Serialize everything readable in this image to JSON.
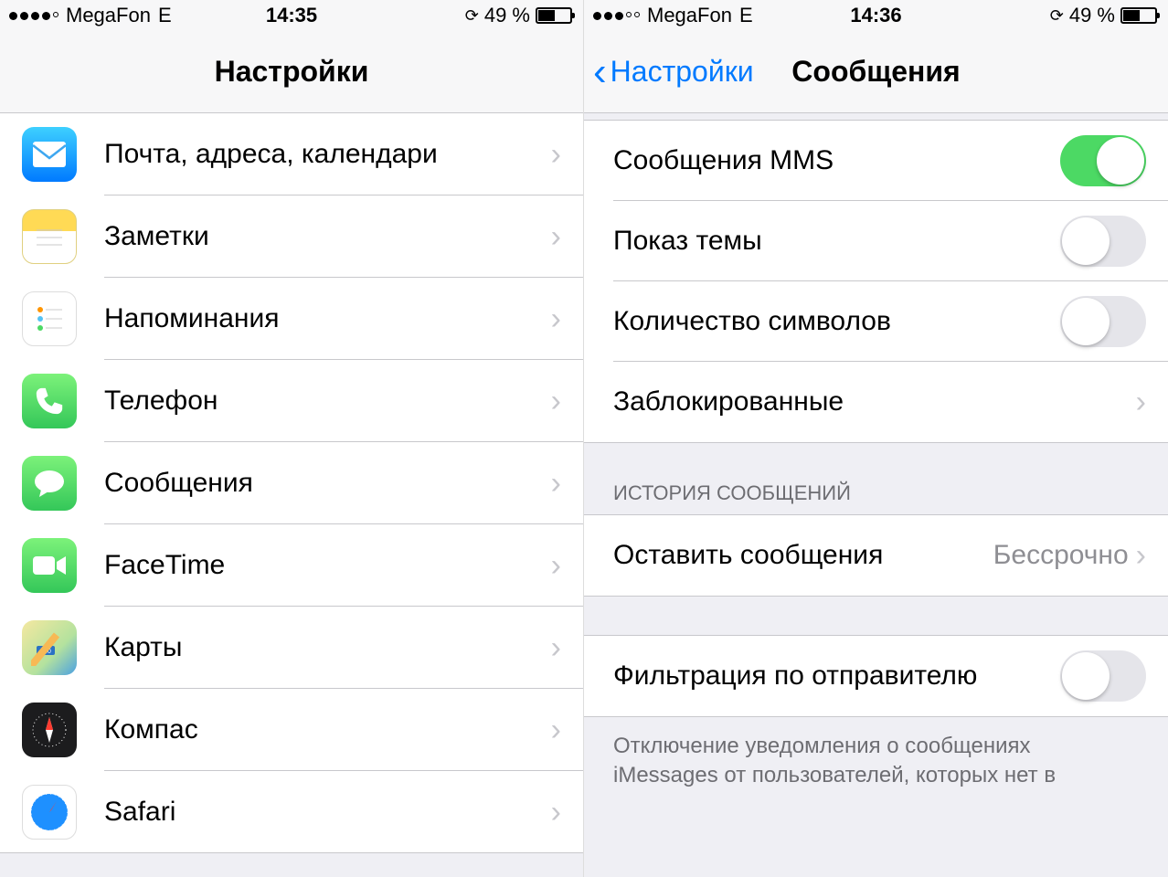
{
  "left": {
    "status": {
      "carrier": "MegaFon",
      "network": "E",
      "time": "14:35",
      "battery": "49 %"
    },
    "title": "Настройки",
    "items": [
      {
        "label": "Почта, адреса, календари",
        "icon": "mail"
      },
      {
        "label": "Заметки",
        "icon": "notes"
      },
      {
        "label": "Напоминания",
        "icon": "reminders"
      },
      {
        "label": "Телефон",
        "icon": "phone"
      },
      {
        "label": "Сообщения",
        "icon": "messages"
      },
      {
        "label": "FaceTime",
        "icon": "facetime"
      },
      {
        "label": "Карты",
        "icon": "maps"
      },
      {
        "label": "Компас",
        "icon": "compass"
      },
      {
        "label": "Safari",
        "icon": "safari"
      }
    ]
  },
  "right": {
    "status": {
      "carrier": "MegaFon",
      "network": "E",
      "time": "14:36",
      "battery": "49 %"
    },
    "back": "Настройки",
    "title": "Сообщения",
    "toggles": [
      {
        "label": "Сообщения MMS",
        "on": true
      },
      {
        "label": "Показ темы",
        "on": false
      },
      {
        "label": "Количество символов",
        "on": false
      }
    ],
    "blocked": {
      "label": "Заблокированные"
    },
    "history_header": "ИСТОРИЯ СООБЩЕНИЙ",
    "keep": {
      "label": "Оставить сообщения",
      "value": "Бессрочно"
    },
    "filter": {
      "label": "Фильтрация по отправителю",
      "on": false
    },
    "footer": "Отключение уведомления о сообщениях iMessages от пользователей, которых нет в"
  }
}
